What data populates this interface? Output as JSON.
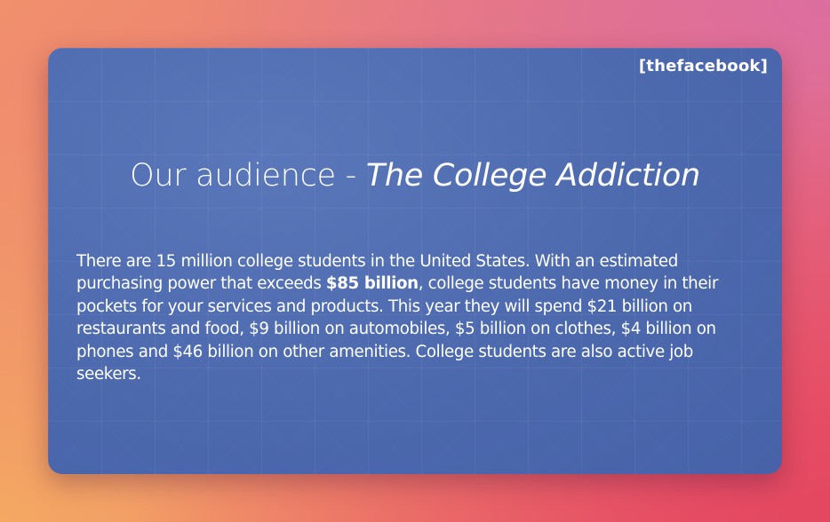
{
  "slide": {
    "logo": "[thefacebook]",
    "title": {
      "plain": "Our audience - ",
      "italic": "The College Addiction"
    },
    "body": {
      "part1": "There are 15 million college students in the United States. With an estimated purchasing power that exceeds ",
      "bold": "$85 billion",
      "part2": ", college students have money in their pockets for your services and products. This year they will spend $21 billion on restaurants and food, $9 billion on automobiles, $5 billion on clothes, $4 billion on phones and $46 billion on other amenities. College students are also active job seekers."
    }
  }
}
